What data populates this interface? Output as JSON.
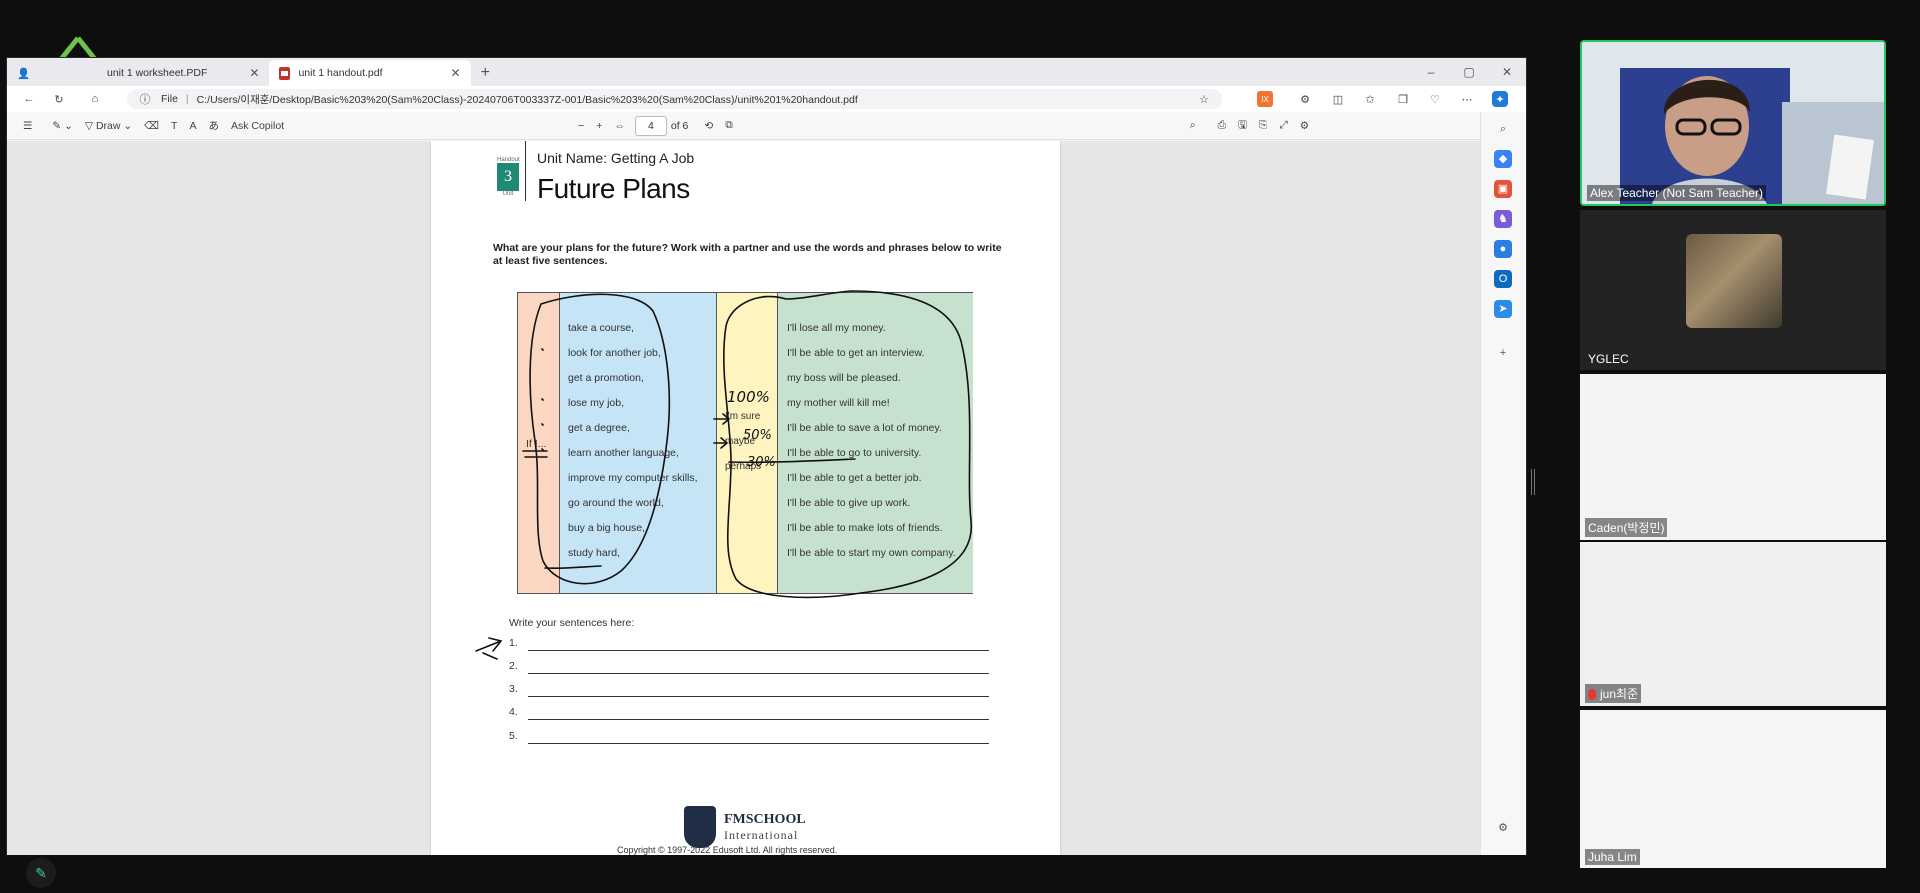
{
  "browser": {
    "tabs": [
      {
        "label": "unit 1 worksheet.PDF",
        "active": false
      },
      {
        "label": "unit 1 handout.pdf",
        "active": true
      }
    ],
    "new_tab": "+",
    "window_controls": {
      "minimize": "–",
      "restore": "▢",
      "close": "✕"
    },
    "address": {
      "scheme_label": "File",
      "url": "C:/Users/이재훈/Desktop/Basic%203%20(Sam%20Class)-20240706T003337Z-001/Basic%203%20(Sam%20Class)/unit%201%20handout.pdf"
    }
  },
  "pdf_toolbar": {
    "draw_label": "Draw",
    "copilot_label": "Ask Copilot",
    "zoom_out": "−",
    "zoom_in": "+",
    "page_current": "4",
    "page_total": "of 6"
  },
  "document": {
    "handout_label": "Handout",
    "unit_number": "3",
    "unit_label": "Unit",
    "unit_name": "Unit Name: Getting A Job",
    "title": "Future Plans",
    "instructions": "What are your plans for the future? Work with a partner and use the words and phrases below to write at least five sentences.",
    "if_label": "If I...",
    "conditions": [
      "take a course,",
      "look for another job,",
      "get a promotion,",
      "lose my job,",
      "get a degree,",
      "learn another language,",
      "improve my computer skills,",
      "go around the world,",
      "buy a big house,",
      "study hard,"
    ],
    "certainty": [
      "I'm sure",
      "maybe",
      "perhaps"
    ],
    "results": [
      "I'll lose all my money.",
      "I'll be able to get an interview.",
      "my boss will be pleased.",
      "my mother will kill me!",
      "I'll be able to save a lot of money.",
      "I'll be able to go to university.",
      "I'll be able to get a better job.",
      "I'll be able to give up work.",
      "I'll be able to make lots of friends.",
      "I'll be able to start my own company."
    ],
    "write_here": "Write your sentences here:",
    "numbers": [
      "1.",
      "2.",
      "3.",
      "4.",
      "5."
    ],
    "school_name": "FMSCHOOL",
    "school_sub": "International",
    "copyright": "Copyright © 1997-2022 Edusoft Ltd. All rights reserved."
  },
  "annotations": {
    "hundred": "100%",
    "fifty": "50%",
    "thirty": "30%"
  },
  "participants": [
    {
      "name": "Alex Teacher (Not Sam Teacher)",
      "active_speaker": true
    },
    {
      "name": "YGLEC"
    },
    {
      "name": "Caden(박정민)"
    },
    {
      "name": "jun최준",
      "muted": true
    },
    {
      "name": "Juha Lim"
    }
  ],
  "colors": {
    "active_speaker_border": "#22c55e",
    "pdf_icon": "#c4302b",
    "col_if": "#fbd6c1",
    "col_condition": "#c5e4f6",
    "col_certainty": "#fdf4c0",
    "col_result": "#c7e1cf",
    "ink": "#111111"
  }
}
